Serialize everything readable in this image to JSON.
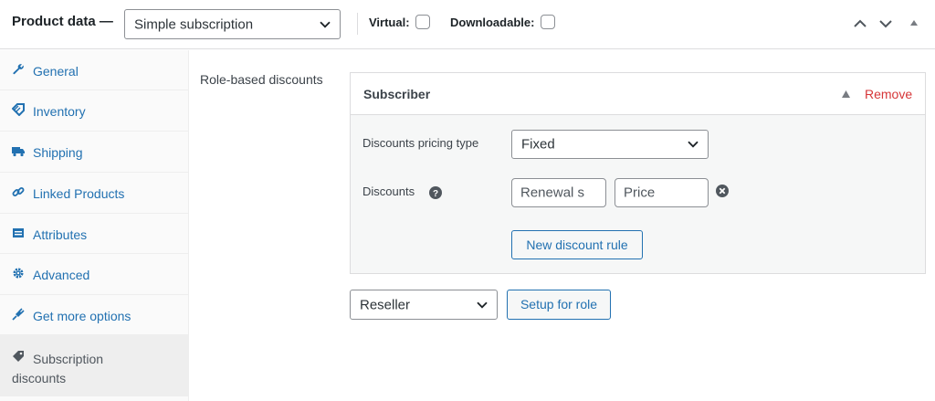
{
  "header": {
    "title": "Product data —",
    "product_type": "Simple subscription",
    "virtual_label": "Virtual:",
    "downloadable_label": "Downloadable:"
  },
  "tabs": [
    {
      "label": "General",
      "icon": "wrench-icon"
    },
    {
      "label": "Inventory",
      "icon": "tag-icon"
    },
    {
      "label": "Shipping",
      "icon": "truck-icon"
    },
    {
      "label": "Linked Products",
      "icon": "link-icon"
    },
    {
      "label": "Attributes",
      "icon": "list-icon"
    },
    {
      "label": "Advanced",
      "icon": "gear-icon"
    },
    {
      "label": "Get more options",
      "icon": "plug-icon"
    },
    {
      "label": "Subscription",
      "label2": "discounts",
      "icon": "price-tag-icon",
      "active": true
    }
  ],
  "main": {
    "section_label": "Role-based discounts",
    "role_panel": {
      "title": "Subscriber",
      "remove_label": "Remove",
      "pricing_type_label": "Discounts pricing type",
      "pricing_type_value": "Fixed",
      "discounts_label": "Discounts",
      "renewal_placeholder": "Renewal s",
      "price_placeholder": "Price",
      "new_rule_label": "New discount rule"
    },
    "role_select_value": "Reseller",
    "setup_label": "Setup for role"
  },
  "colors": {
    "link": "#2271b1",
    "remove": "#d63638",
    "tab_active_bg": "#eeeeee",
    "border": "#dcdcde"
  }
}
